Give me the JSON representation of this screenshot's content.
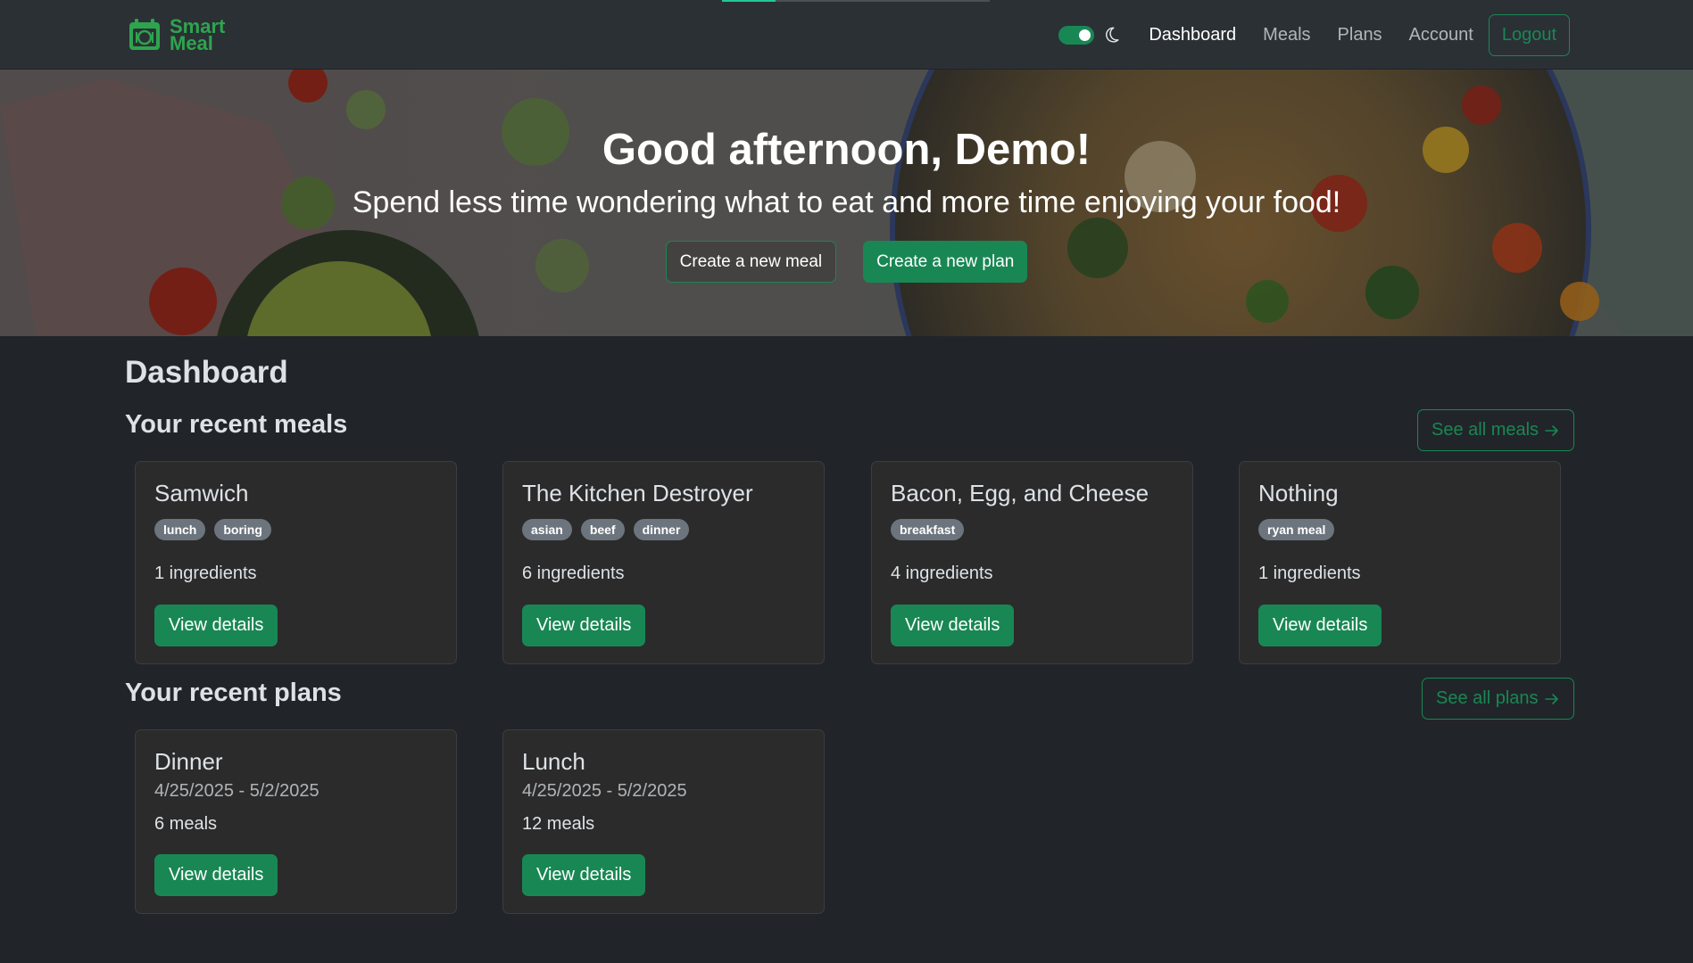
{
  "brand": {
    "line1": "Smart",
    "line2": "Meal",
    "icon": "calendar-icon"
  },
  "nav": {
    "progress_fraction": 0.2,
    "theme_toggle_on": true,
    "links": [
      "Dashboard",
      "Meals",
      "Plans",
      "Account"
    ],
    "active": "Dashboard",
    "logout_label": "Logout"
  },
  "hero": {
    "title": "Good afternoon, Demo!",
    "subtitle": "Spend less time wondering what to eat and more time enjoying your food!",
    "create_meal_label": "Create a new meal",
    "create_plan_label": "Create a new plan"
  },
  "page_title": "Dashboard",
  "recent_meals": {
    "heading": "Your recent meals",
    "see_all_label": "See all meals",
    "items": [
      {
        "name": "Samwich",
        "tags": [
          "lunch",
          "boring"
        ],
        "ingredients": "1 ingredients",
        "button": "View details"
      },
      {
        "name": "The Kitchen Destroyer",
        "tags": [
          "asian",
          "beef",
          "dinner"
        ],
        "ingredients": "6 ingredients",
        "button": "View details"
      },
      {
        "name": "Bacon, Egg, and Cheese",
        "tags": [
          "breakfast"
        ],
        "ingredients": "4 ingredients",
        "button": "View details"
      },
      {
        "name": "Nothing",
        "tags": [
          "ryan meal"
        ],
        "ingredients": "1 ingredients",
        "button": "View details"
      }
    ]
  },
  "recent_plans": {
    "heading": "Your recent plans",
    "see_all_label": "See all plans",
    "items": [
      {
        "name": "Dinner",
        "dates": "4/25/2025 - 5/2/2025",
        "meals": "6 meals",
        "button": "View details"
      },
      {
        "name": "Lunch",
        "dates": "4/25/2025 - 5/2/2025",
        "meals": "12 meals",
        "button": "View details"
      }
    ]
  },
  "colors": {
    "accent": "#198754",
    "brand": "#2ea44f",
    "background": "#212529",
    "navbar": "#2b3035",
    "card": "#2b2b2b",
    "badge": "#6c757d"
  }
}
